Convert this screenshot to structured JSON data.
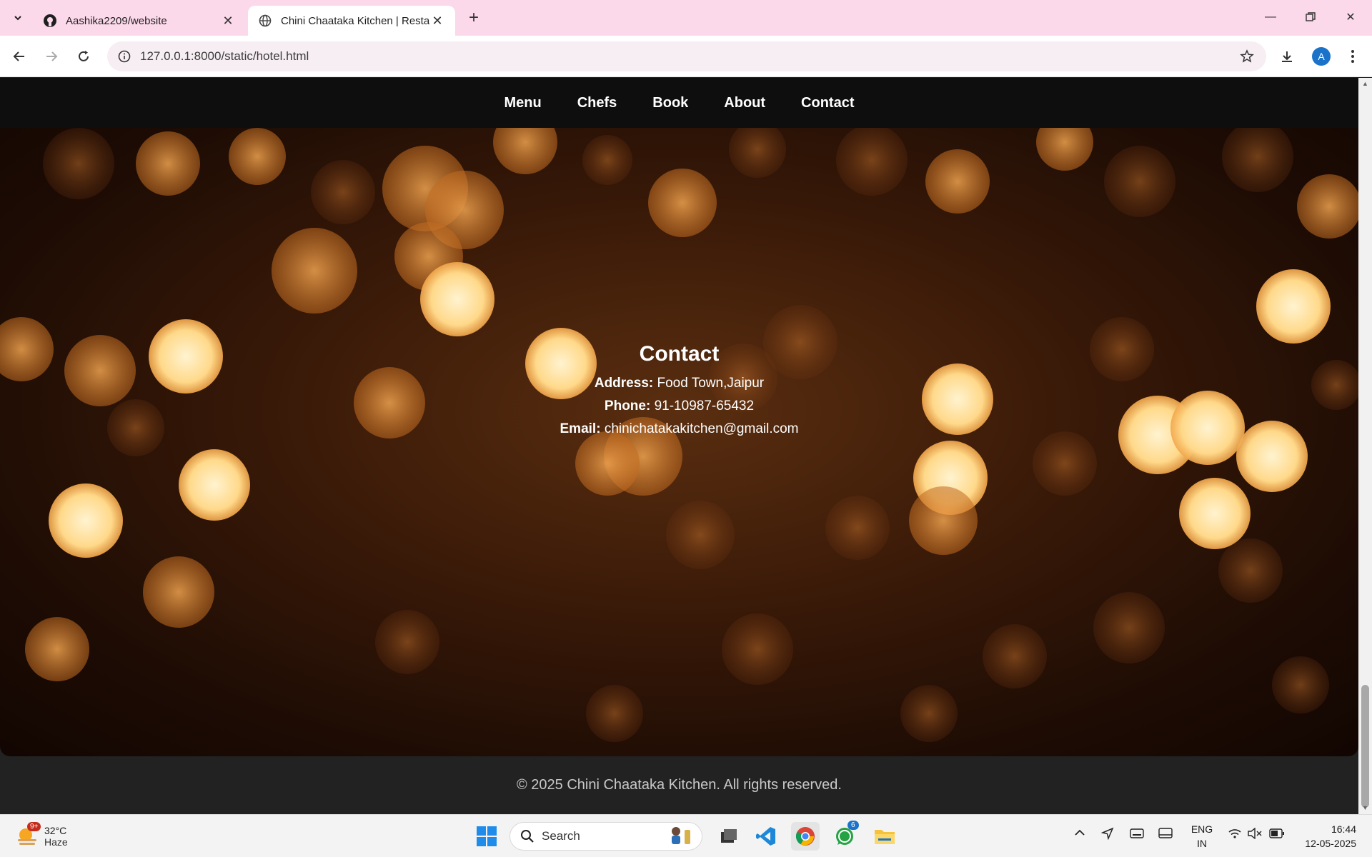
{
  "browser": {
    "tabs": [
      {
        "title": "Aashika2209/website",
        "icon": "github-icon",
        "active": false
      },
      {
        "title": "Chini Chaataka Kitchen | Restau",
        "icon": "globe-icon",
        "active": true
      }
    ],
    "url": "127.0.0.1:8000/static/hotel.html",
    "profile_initial": "A"
  },
  "site": {
    "nav": [
      "Menu",
      "Chefs",
      "Book",
      "About",
      "Contact"
    ],
    "contact": {
      "heading": "Contact",
      "address_label": "Address:",
      "address": "Food Town,Jaipur",
      "phone_label": "Phone:",
      "phone": "91-10987-65432",
      "email_label": "Email:",
      "email": "chinichatakakitchen@gmail.com"
    },
    "footer": "© 2025 Chini Chaataka Kitchen. All rights reserved."
  },
  "taskbar": {
    "weather_temp": "32°C",
    "weather_desc": "Haze",
    "weather_badge": "9+",
    "search_label": "Search",
    "whatsapp_badge": "6",
    "lang_line1": "ENG",
    "lang_line2": "IN",
    "time": "16:44",
    "date": "12-05-2025"
  },
  "colors": {
    "tabbar": "#fbd9ea",
    "nav_bg": "#0e0e0e",
    "footer_bg": "#222222",
    "bokeh": "#ffb347"
  }
}
